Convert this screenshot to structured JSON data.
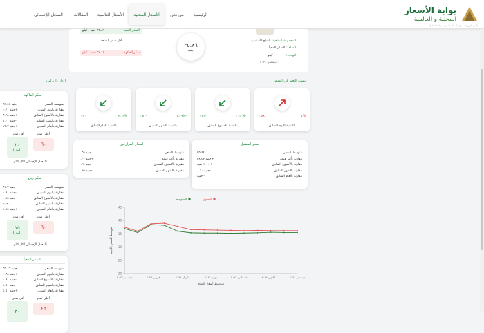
{
  "header": {
    "title": "بوابة الأسعار",
    "subtitle": "المحلية و العالمية",
    "org": "مجلس الوزراء - مركز المعلومات ودعم اتخاذ القرار",
    "nav": [
      "الرئيسية",
      "من نحن",
      "الأسعار المحلية",
      "الأسعار العالمية",
      "المقالات",
      "السجل الإحصائي"
    ],
    "active_index": 2
  },
  "product": {
    "group_label": "المجموعة السلعية:",
    "group_value": "السلع الأساسية",
    "commodity_label": "السلعة:",
    "commodity_value": "السكر المعبأ",
    "unit_label": "الوحدة:",
    "unit_value": "كيلو",
    "date": "٣ ديسمبر ٢٠٢٤",
    "price_value": "٣٥.٨٦",
    "price_unit": "جنيه",
    "top_label": "السعر المعبأ",
    "top_value": "٣٥.٨٦",
    "top_suffix": "جنيه / كيلو",
    "top_value_full": "٣٥.٨٦ جنيه / كيلو",
    "cheapest_label": "أقل سعر السلعة",
    "bread_label": "سكر الفاكهة",
    "bread_value": "٣٧.٨٥ جنيه / كيلو"
  },
  "changes": {
    "title": "نسب التغير في السعر",
    "cards": [
      {
        "label": "بالنسبة لليوم السابق",
        "pct": "٤%",
        "val": "٠.٨٨",
        "dir": "up",
        "color": "#d32f2f"
      },
      {
        "label": "بالنسبة للأسبوع السابق",
        "pct": "٠.٦٣%-",
        "val": "٠.٢٣-",
        "dir": "down",
        "color": "#1b8a3d"
      },
      {
        "label": "بالنسبة للشهر السابق",
        "pct": "١.٣٩%-",
        "val": "٠.٥٠-",
        "dir": "down",
        "color": "#1b8a3d"
      },
      {
        "label": "بالنسبة للعام السابق",
        "pct": "٢.٠٣%",
        "val": "٠.٧٠",
        "dir": "down",
        "color": "#1b8a3d"
      }
    ]
  },
  "summary_left": {
    "title": "سعر المشيل",
    "rows": [
      {
        "label": "متوسط السعر",
        "value": "٣٥.٤٤"
      },
      {
        "label": "مقارنة بأكثر قيمة",
        "value": "جنيه ٣٨.٥٢+"
      },
      {
        "label": "مقارنة بالأسبوع السابق",
        "value": "٠.١١-٪ جنيه"
      },
      {
        "label": "مقارنة بالشهر السابق",
        "value": "جنيه ٠.١٠-"
      },
      {
        "label": "مقارنة بالعام السابق",
        "value": "جنيه -"
      }
    ]
  },
  "summary_right": {
    "title": "أسعار المزارعين",
    "rows": [
      {
        "label": "متوسط السعر",
        "value": "جنيه ٠.٣٥"
      },
      {
        "label": "مقارنة بأكثر قيمة",
        "value": "جنيه ٠.٠٧+"
      },
      {
        "label": "مقارنة بالأسبوع السابق",
        "value": "جنيه ٠.٢٥-"
      },
      {
        "label": "مقارنة بالشهر السابق",
        "value": "جنيه ٠.٨٥-"
      }
    ]
  },
  "chart_data": {
    "type": "line",
    "x": [
      "ديسمبر ٢٠٢٣",
      "فبراير ٢٠٢٤",
      "أبريل ٢٠٢٤",
      "يونيو ٢٠٢٤",
      "أغسطس ٢٠٢٤",
      "أكتوبر ٢٠٢٤",
      "ديسمبر ٢٠٢٤"
    ],
    "series": [
      {
        "name": "المتوسط",
        "color": "#2e7d32",
        "values": [
          37,
          35.5,
          38.5,
          38.2,
          36,
          35.4,
          35.3,
          35.3,
          35.2,
          35.3,
          35.4,
          35.6,
          35.5,
          35.5
        ]
      },
      {
        "name": "السوق",
        "color": "#e05050",
        "values": [
          37.5,
          36,
          38.8,
          39,
          37.8,
          36.6,
          36.5,
          36.4,
          36.3,
          36.2,
          36.3,
          36.2,
          36.2,
          36.2
        ]
      }
    ],
    "xlabel": "متوسط أسعار السلع",
    "ylabel": "متوسط السعر بالجنيه",
    "ylim": [
      20,
      45
    ]
  },
  "sidebar": {
    "title": "الفئات السلعية",
    "cards": [
      {
        "title": "سكر الفاكهة",
        "rows": [
          {
            "label": "متوسط السعر",
            "value": "جنيه ٣٨.٤٨"
          },
          {
            "label": "مقارنة باليوم السابق",
            "value": "جنيه ٠.٢٠+"
          },
          {
            "label": "مقارنة بالأسبوع السابق",
            "value": "جنيه ٣.٢٨+"
          },
          {
            "label": "مقارنة بالشهر السابق",
            "value": "جنيه ١.٠٠-"
          },
          {
            "label": "مقارنة بالعام السابق",
            "value": "جنيه ١٣.٣+"
          }
        ],
        "low_label": "أعلى سعر",
        "low_value": "٦٠",
        "min_label": "أقل سعر",
        "min_value": "٢٠",
        "min_sub": "المنيا",
        "footer": "المعدل الإجمالي لكل كيلو"
      },
      {
        "title": "سكر زيرو",
        "rows": [
          {
            "label": "متوسط السعر",
            "value": "جنيه ٣١.٢"
          },
          {
            "label": "مقارنة باليوم السابق",
            "value": "جنيه ٠.٩٠-"
          },
          {
            "label": "مقارنة بالأسبوع السابق",
            "value": "جنيه ٠.٤٥-"
          },
          {
            "label": "مقارنة بالشهر السابق",
            "value": "جنيه -"
          },
          {
            "label": "مقارنة بالعام السابق",
            "value": "جنيه ١.٨٥+"
          }
        ],
        "low_label": "أعلى سعر",
        "low_value": "٦٠",
        "min_label": "أقل سعر",
        "min_value": "١٥",
        "min_sub": "المنيا",
        "footer": "المعدل الإجمالي لكل كيلو"
      },
      {
        "title": "السكر المعبأ",
        "rows": [
          {
            "label": "متوسط السعر",
            "value": "جنيه ٣٥.٨٦"
          },
          {
            "label": "مقارنة باليوم السابق",
            "value": "جنيه ٠.٣٨+"
          },
          {
            "label": "مقارنة بالأسبوع السابق",
            "value": "جنيه ٠.٩١-"
          },
          {
            "label": "مقارنة بالشهر السابق",
            "value": "جنيه ١.٥٠-"
          },
          {
            "label": "مقارنة بالعام السابق",
            "value": "جنيه ٤.٥٠+"
          }
        ],
        "low_label": "أعلى سعر",
        "low_value": "٤٥",
        "min_label": "أقل سعر",
        "min_value": "٣٠",
        "min_sub": "",
        "footer": ""
      }
    ]
  }
}
